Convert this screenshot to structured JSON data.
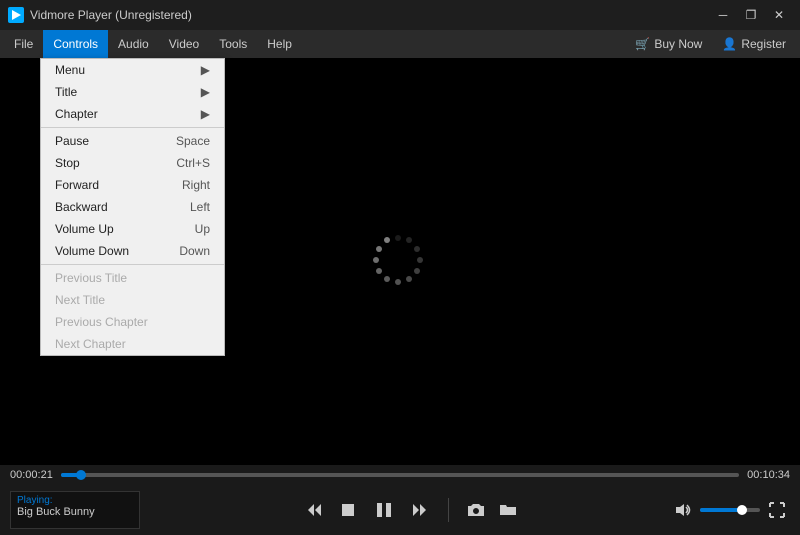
{
  "titleBar": {
    "title": "Vidmore Player (Unregistered)",
    "icon": "▶",
    "minimizeLabel": "─",
    "restoreLabel": "❐",
    "closeLabel": "✕"
  },
  "menuBar": {
    "items": [
      {
        "label": "File",
        "id": "file"
      },
      {
        "label": "Controls",
        "id": "controls",
        "active": true
      },
      {
        "label": "Audio",
        "id": "audio"
      },
      {
        "label": "Video",
        "id": "video"
      },
      {
        "label": "Tools",
        "id": "tools"
      },
      {
        "label": "Help",
        "id": "help"
      }
    ],
    "buyNow": "Buy Now",
    "register": "Register"
  },
  "controlsMenu": {
    "items": [
      {
        "label": "Menu",
        "shortcut": "",
        "hasArrow": true,
        "disabled": false
      },
      {
        "label": "Title",
        "shortcut": "",
        "hasArrow": true,
        "disabled": false
      },
      {
        "label": "Chapter",
        "shortcut": "",
        "hasArrow": true,
        "disabled": false
      },
      {
        "separator": true
      },
      {
        "label": "Pause",
        "shortcut": "Space",
        "disabled": false
      },
      {
        "label": "Stop",
        "shortcut": "Ctrl+S",
        "disabled": false
      },
      {
        "label": "Forward",
        "shortcut": "Right",
        "disabled": false
      },
      {
        "label": "Backward",
        "shortcut": "Left",
        "disabled": false
      },
      {
        "label": "Volume Up",
        "shortcut": "Up",
        "disabled": false
      },
      {
        "label": "Volume Down",
        "shortcut": "Down",
        "disabled": false
      },
      {
        "separator": true
      },
      {
        "label": "Previous Title",
        "shortcut": "",
        "disabled": true
      },
      {
        "label": "Next Title",
        "shortcut": "",
        "disabled": true
      },
      {
        "label": "Previous Chapter",
        "shortcut": "",
        "disabled": true
      },
      {
        "label": "Next Chapter",
        "shortcut": "",
        "disabled": true
      }
    ]
  },
  "player": {
    "currentTime": "00:00:21",
    "totalTime": "00:10:34",
    "progressPercent": 3,
    "volumePercent": 70
  },
  "nowPlaying": {
    "label": "Playing:",
    "title": "Big Buck Bunny"
  },
  "controls": {
    "rewindLabel": "⏮",
    "stopLabel": "■",
    "pauseLabel": "⏸",
    "forwardLabel": "⏭",
    "screenshotLabel": "📷",
    "folderLabel": "📁",
    "volumeLabel": "🔊",
    "fullscreenLabel": "⛶"
  }
}
